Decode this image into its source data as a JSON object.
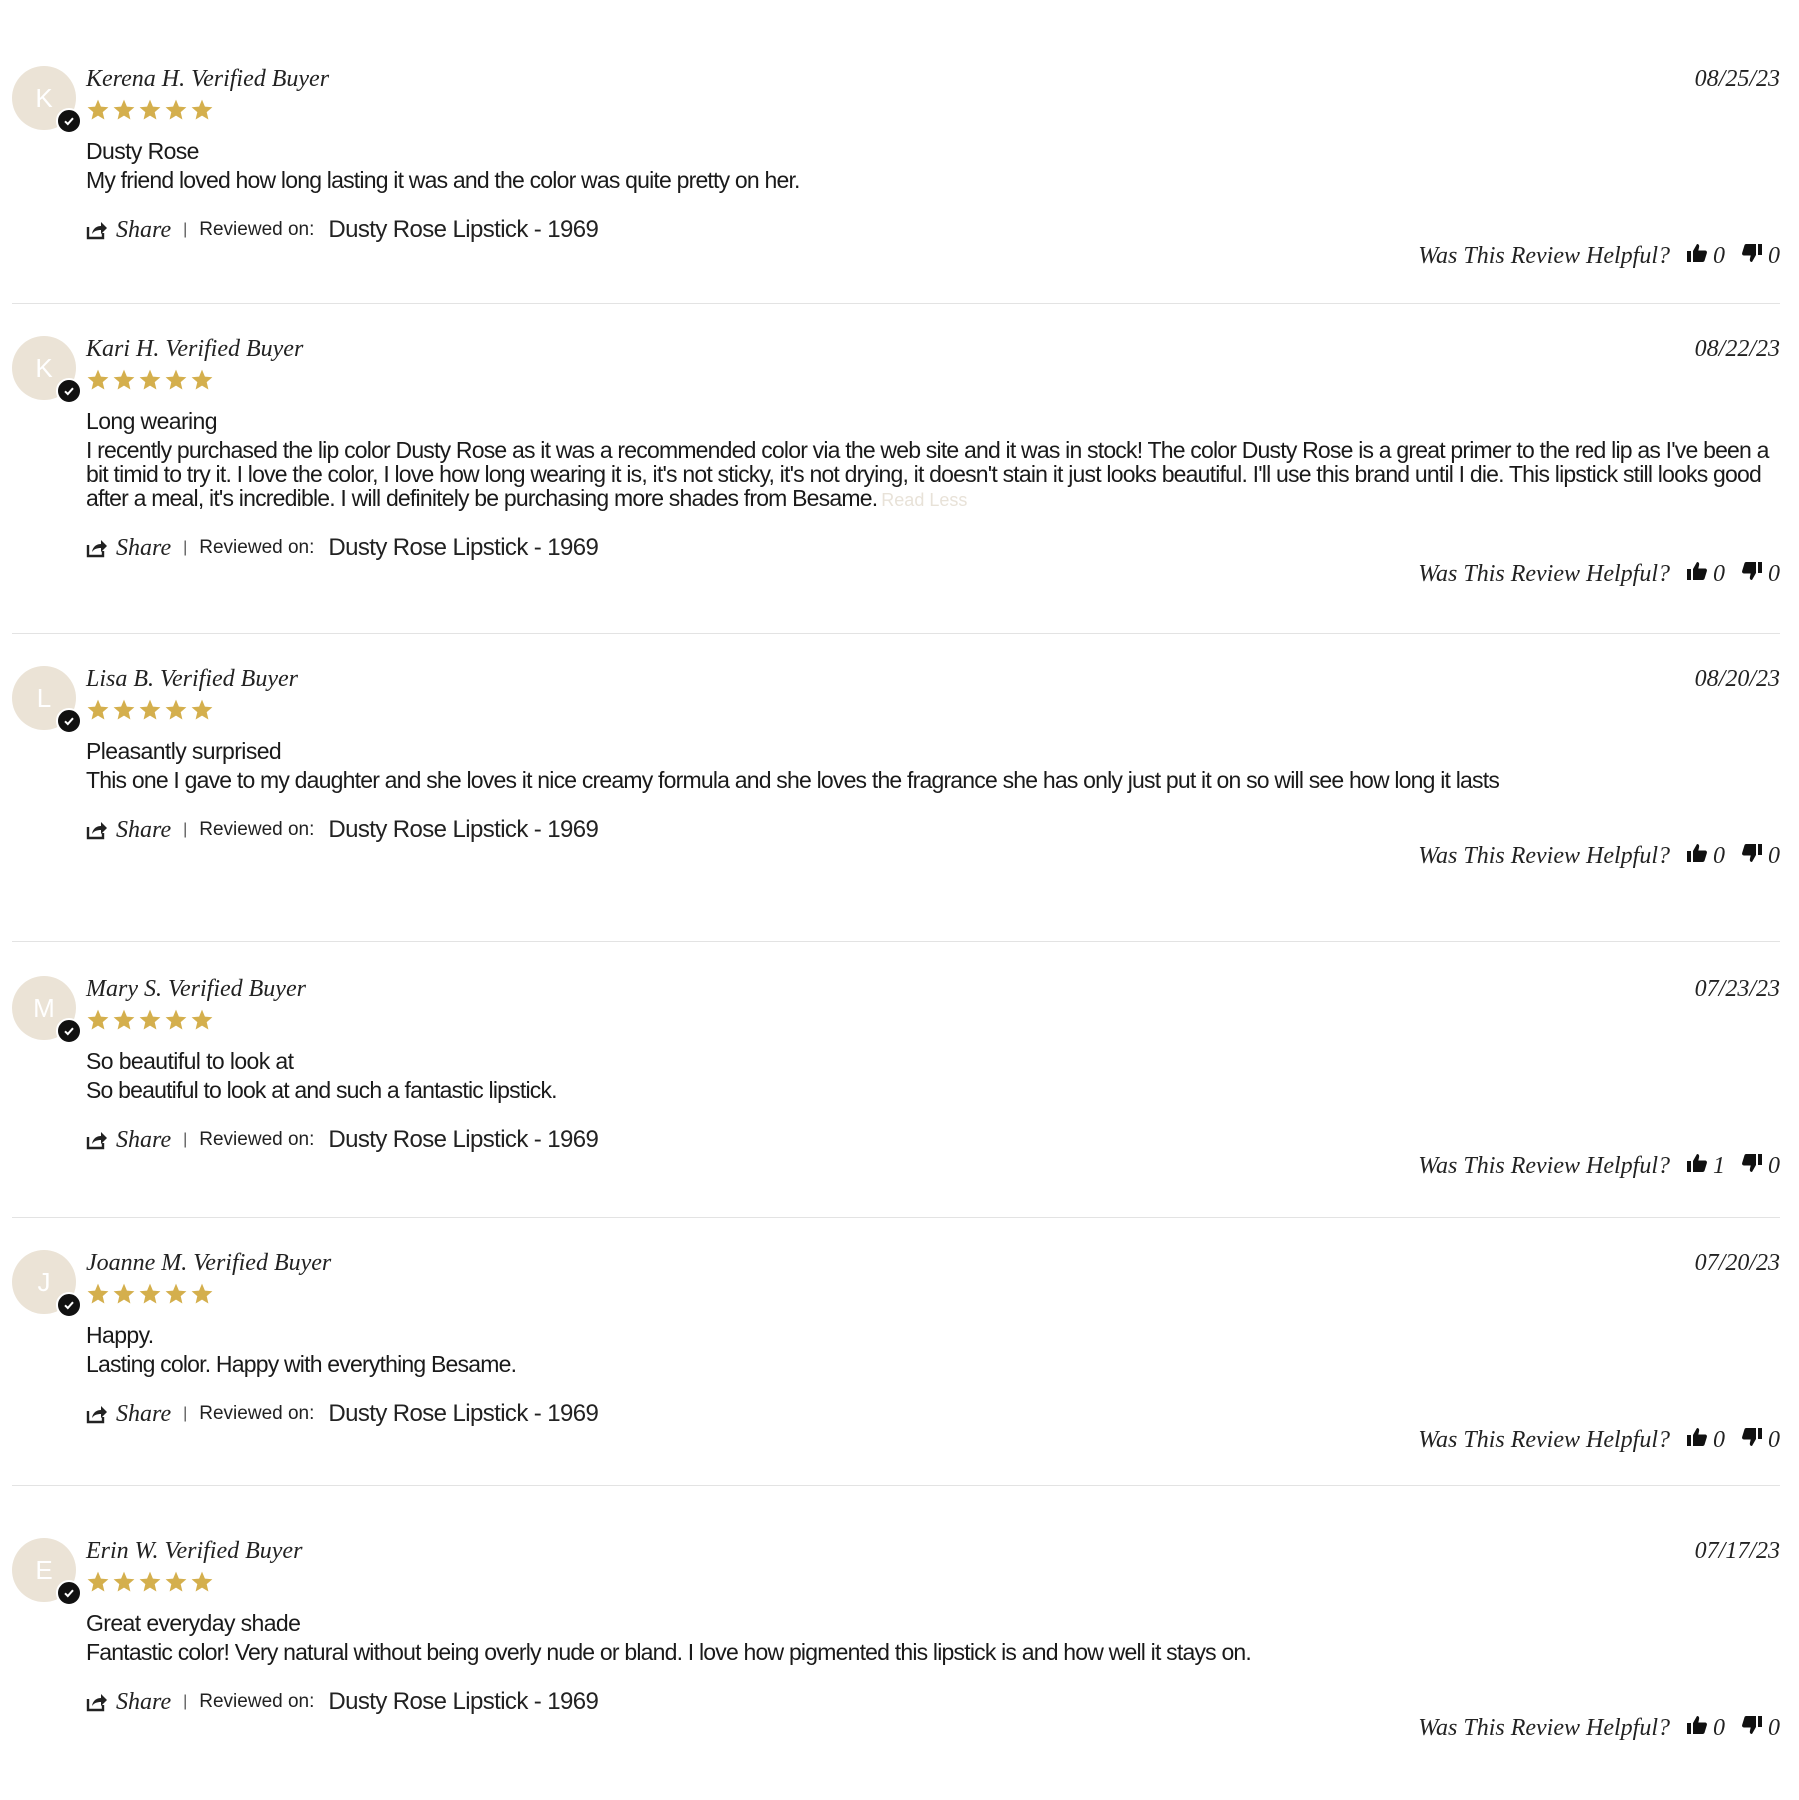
{
  "labels": {
    "share": "Share",
    "reviewed_on": "Reviewed on:",
    "helpful": "Was This Review Helpful?",
    "read_less": "Read Less"
  },
  "colors": {
    "star": "#d4af4d",
    "avatar_bg": "#ebe3d6",
    "badge": "#111111"
  },
  "reviews": [
    {
      "initial": "K",
      "author": "Kerena H. Verified Buyer",
      "date": "08/25/23",
      "stars": 5,
      "title": "Dusty Rose",
      "body": "My friend loved how long lasting it was and the color was quite pretty on her.",
      "product": "Dusty Rose Lipstick - 1969",
      "helpful_yes": "0",
      "helpful_no": "0"
    },
    {
      "initial": "K",
      "author": "Kari H. Verified Buyer",
      "date": "08/22/23",
      "stars": 5,
      "title": "Long wearing",
      "body": "I recently purchased the lip color Dusty Rose as it was a recommended color via the web site and it was in stock! The color Dusty Rose is a great primer to the red lip as I've been a bit timid to try it. I love the color, I love how long wearing it is, it's not sticky, it's not drying, it doesn't stain it just looks beautiful. I'll use this brand until I die. This lipstick still looks good after a meal, it's incredible. I will definitely be purchasing more shades from Besame.",
      "product": "Dusty Rose Lipstick - 1969",
      "helpful_yes": "0",
      "helpful_no": "0"
    },
    {
      "initial": "L",
      "author": "Lisa B. Verified Buyer",
      "date": "08/20/23",
      "stars": 5,
      "title": "Pleasantly surprised",
      "body": "This one I gave to my daughter and she loves it nice creamy formula and she loves the fragrance she has only just put it on so will see how long it lasts",
      "product": "Dusty Rose Lipstick - 1969",
      "helpful_yes": "0",
      "helpful_no": "0"
    },
    {
      "initial": "M",
      "author": "Mary S. Verified Buyer",
      "date": "07/23/23",
      "stars": 5,
      "title": "So beautiful to look at",
      "body": "So beautiful to look at and such a fantastic lipstick.",
      "product": "Dusty Rose Lipstick - 1969",
      "helpful_yes": "1",
      "helpful_no": "0"
    },
    {
      "initial": "J",
      "author": "Joanne M. Verified Buyer",
      "date": "07/20/23",
      "stars": 5,
      "title": "Happy.",
      "body": "Lasting color. Happy with everything Besame.",
      "product": "Dusty Rose Lipstick - 1969",
      "helpful_yes": "0",
      "helpful_no": "0"
    },
    {
      "initial": "E",
      "author": "Erin W. Verified Buyer",
      "date": "07/17/23",
      "stars": 5,
      "title": "Great everyday shade",
      "body": "Fantastic color! Very natural without being overly nude or bland. I love how pigmented this lipstick is and how well it stays on.",
      "product": "Dusty Rose Lipstick - 1969",
      "helpful_yes": "0",
      "helpful_no": "0"
    }
  ]
}
